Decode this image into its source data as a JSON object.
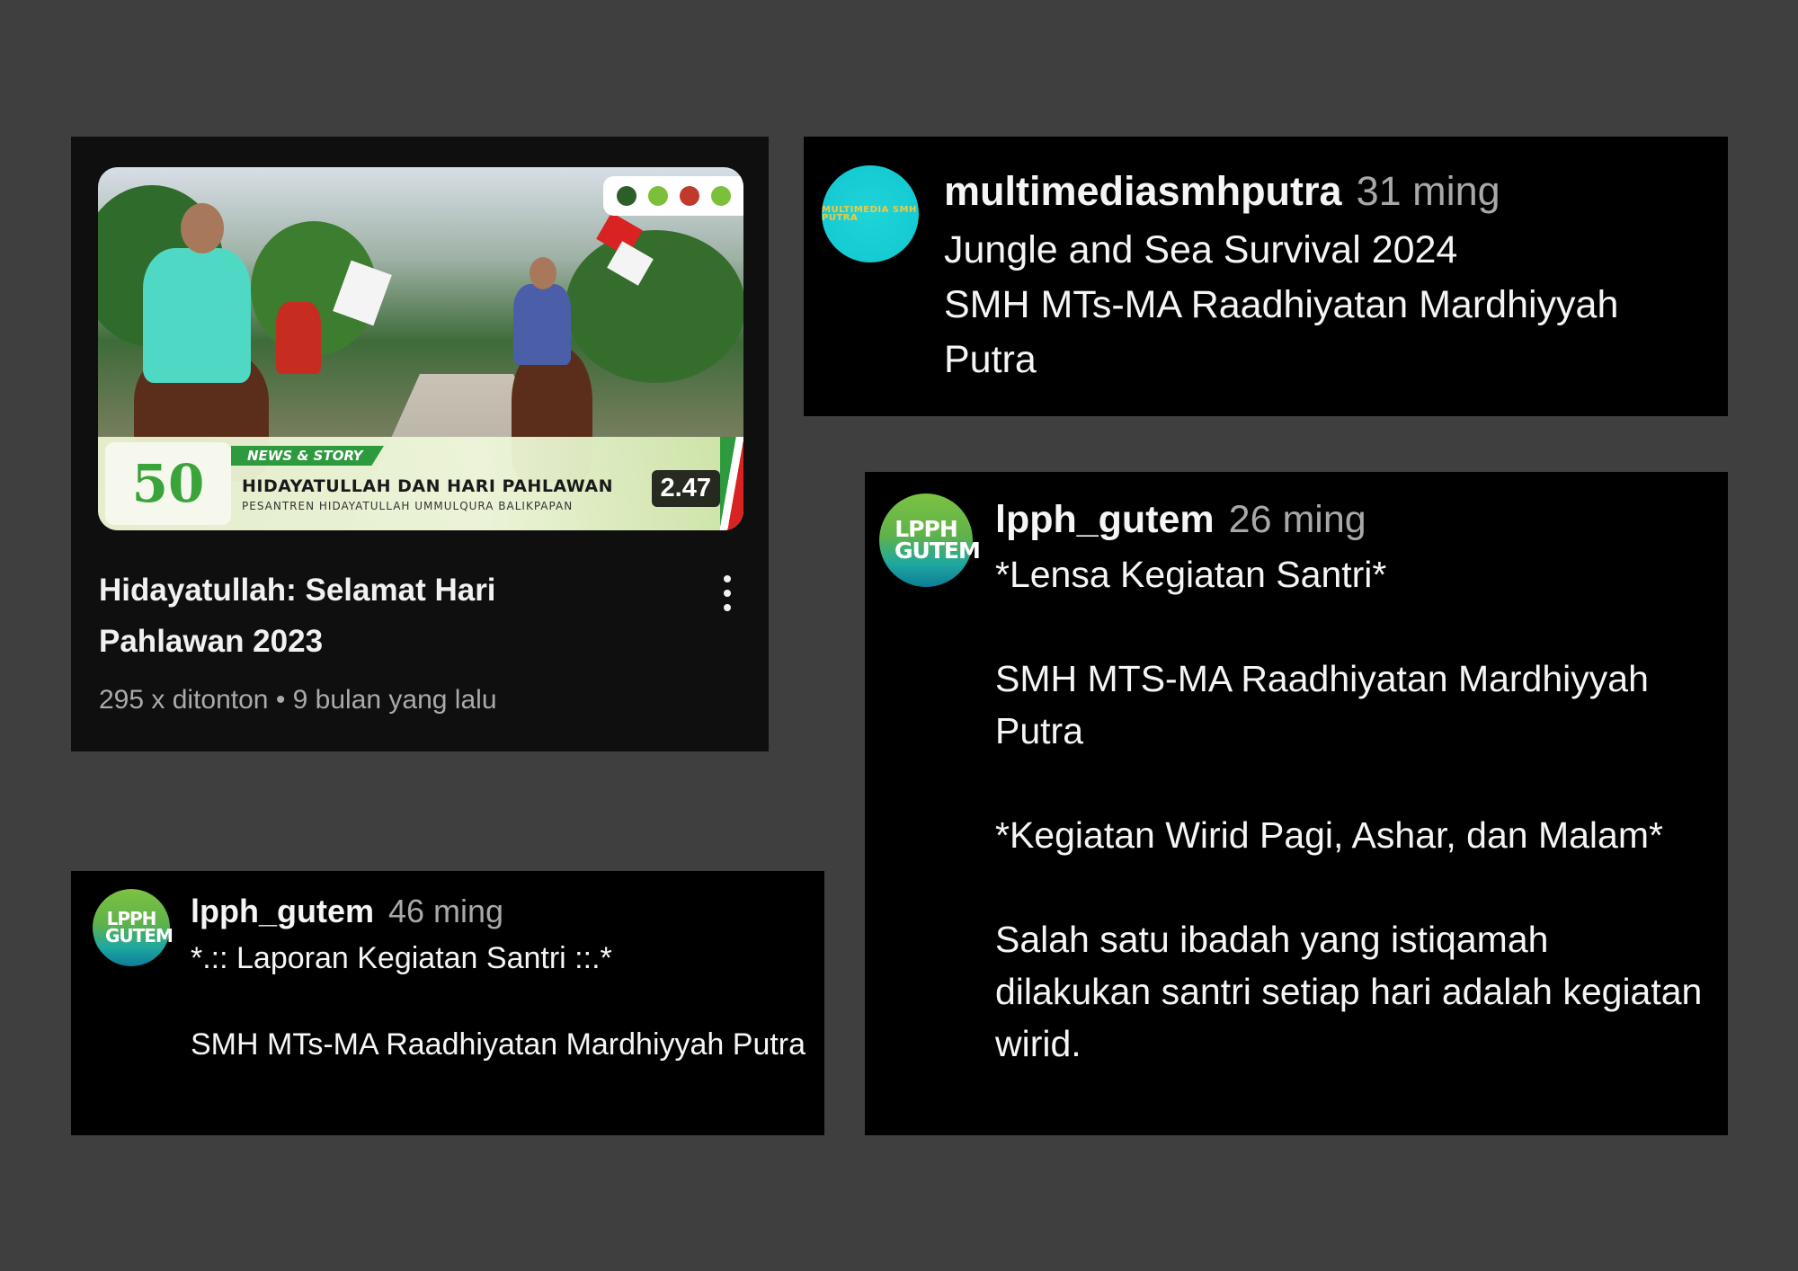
{
  "video": {
    "thumbnail": {
      "tag": "NEWS & STORY",
      "title": "HIDAYATULLAH DAN HARI PAHLAWAN",
      "subtitle": "PESANTREN HIDAYATULLAH UMMULQURA BALIKPAPAN",
      "badge_number": "50"
    },
    "duration": "2.47",
    "title": "Hidayatullah: Selamat Hari Pahlawan 2023",
    "meta": "295 x ditonton • 9 bulan yang lalu",
    "menu_icon": "more-vert-icon"
  },
  "comments": [
    {
      "avatar_text": "MULTIMEDIA SMH PUTRA",
      "username": "multimediasmhputra",
      "age": "31 ming",
      "text": "Jungle and Sea Survival 2024\nSMH MTs-MA Raadhiyatan Mardhiyyah Putra"
    },
    {
      "avatar_text": "LPPH GUTEM",
      "username": "lpph_gutem",
      "age": "26 ming",
      "text": "*Lensa Kegiatan Santri*\n\nSMH MTS-MA Raadhiyatan Mardhiyyah Putra\n\n*Kegiatan Wirid Pagi, Ashar, dan Malam*\n\nSalah satu ibadah yang istiqamah dilakukan santri setiap hari adalah kegiatan wirid."
    },
    {
      "avatar_text": "LPPH GUTEM",
      "username": "lpph_gutem",
      "age": "46 ming",
      "text": "*.:: Laporan Kegiatan Santri ::.*\n\nSMH MTs-MA Raadhiyatan Mardhiyyah Putra"
    }
  ],
  "colors": {
    "background": "#3f3f3f",
    "panel": "#000000",
    "video_card": "#0f0f0f",
    "muted_text": "#aaaaaa",
    "avatar_cyan": "#11c8d1"
  }
}
